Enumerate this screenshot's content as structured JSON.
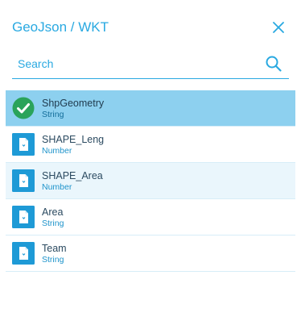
{
  "header": {
    "title": "GeoJson / WKT"
  },
  "search": {
    "placeholder": "Search",
    "value": ""
  },
  "colors": {
    "accent": "#29a9e1",
    "selected_row": "#8dd0ef",
    "hover_row": "#eaf6fc",
    "check_green": "#2aa35a"
  },
  "fields": [
    {
      "name": "ShpGeometry",
      "type": "String",
      "icon": "check-circle-icon",
      "state": "selected"
    },
    {
      "name": "SHAPE_Leng",
      "type": "Number",
      "icon": "document-icon",
      "state": "normal"
    },
    {
      "name": "SHAPE_Area",
      "type": "Number",
      "icon": "document-icon",
      "state": "hover"
    },
    {
      "name": "Area",
      "type": "String",
      "icon": "document-icon",
      "state": "normal"
    },
    {
      "name": "Team",
      "type": "String",
      "icon": "document-icon",
      "state": "normal"
    }
  ]
}
